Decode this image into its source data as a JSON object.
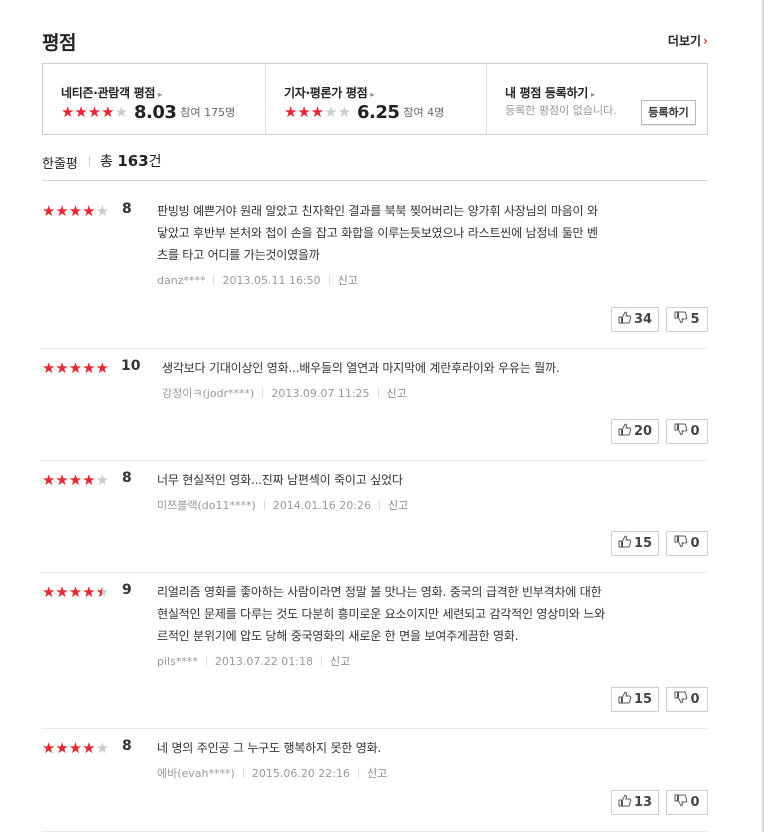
{
  "header": {
    "title": "평점",
    "more_label": "더보기",
    "more_chevron": "›"
  },
  "score_box": {
    "netizen": {
      "title": "네티즌·관람객 평점",
      "arrow": "▸",
      "score": "8.03",
      "participants": "참여 175명",
      "stars": 4,
      "half": 0
    },
    "critic": {
      "title": "기자·평론가 평점",
      "arrow": "▸",
      "score": "6.25",
      "participants": "참여 4명",
      "stars": 3,
      "half": 0
    },
    "mine": {
      "title": "내 평점 등록하기",
      "arrow": "▸",
      "empty_text": "등록한 평점이 없습니다.",
      "register_label": "등록하기"
    }
  },
  "review_header": {
    "label": "한줄평",
    "total_prefix": "총",
    "total_count": "163",
    "total_suffix": "건"
  },
  "reviews": [
    {
      "stars": 4,
      "half": 0,
      "score": "8",
      "lines": [
        "판빙빙 예쁜거야 원래 알았고 친자확인 결과를 북북 찢어버리는 양가휘 사장님의 마음이 와",
        "닿았고 후반부 본처와 첩이 손을 잡고 화합을 이루는듯보였으나 라스트씬에 남정네 둘만 벤",
        "츠를 타고 어디를 가는것이였을까"
      ],
      "author": "danz****",
      "date": "2013.05.11 16:50",
      "report": "신고",
      "up": "34",
      "down": "5"
    },
    {
      "stars": 5,
      "half": 0,
      "score": "10",
      "lines": [
        "생각보다 기대이상인 영화...배우들의 열연과 마지막에 계란후라이와 우유는 뭘까."
      ],
      "author": "강정이ㅋ(jodr****)",
      "date": "2013.09.07 11:25",
      "report": "신고",
      "up": "20",
      "down": "0"
    },
    {
      "stars": 4,
      "half": 0,
      "score": "8",
      "lines": [
        "너무 현실적인 영화...진짜 남편섹이 죽이고 싶었다"
      ],
      "author": "미쯔블랙(do11****)",
      "date": "2014.01.16 20:26",
      "report": "신고",
      "up": "15",
      "down": "0"
    },
    {
      "stars": 4,
      "half": 1,
      "score": "9",
      "lines": [
        "리얼리즘 영화를 좋아하는 사람이라면 정말 볼 맛나는 영화. 중국의 급격한 빈부격차에 대한",
        "현실적인 문제를 다루는 것도 다분히 흥미로운 요소이지만 세련되고 감각적인 영상미와 느와",
        "르적인 분위기에 압도 당해 중국영화의 새로운 한 면을 보여주게끔한 영화."
      ],
      "author": "pils****",
      "date": "2013.07.22 01:18",
      "report": "신고",
      "up": "15",
      "down": "0"
    },
    {
      "stars": 4,
      "half": 0,
      "score": "8",
      "lines": [
        "네 명의 주인공 그 누구도 행복하지 못한 영화."
      ],
      "author": "에바(evah****)",
      "date": "2015.06.20 22:16",
      "report": "신고",
      "up": "13",
      "down": "0"
    }
  ],
  "colors": {
    "star_on": "#e8262f",
    "star_off": "#cccccc",
    "accent": "#e3342f"
  },
  "icons": {
    "star": "★",
    "thumbs_up": "thumbs-up-icon",
    "thumbs_down": "thumbs-down-icon"
  }
}
